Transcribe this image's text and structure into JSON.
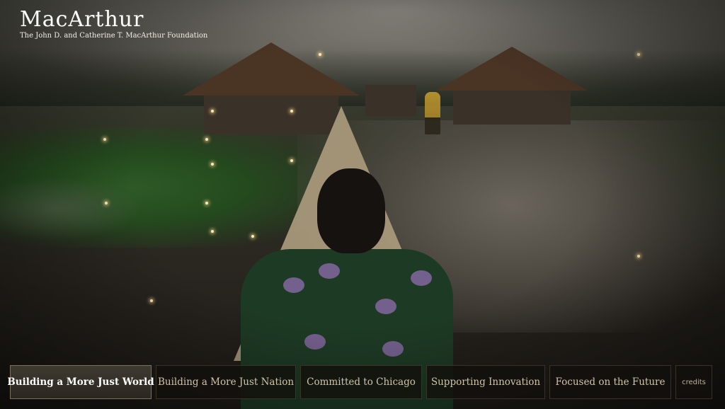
{
  "logo": {
    "title": "MacArthur",
    "subtitle": "The John D. and Catherine T. MacArthur Foundation"
  },
  "nav": {
    "items": [
      {
        "label": "Building a More Just World",
        "active": true
      },
      {
        "label": "Building a More Just Nation",
        "active": false
      },
      {
        "label": "Committed to Chicago",
        "active": false
      },
      {
        "label": "Supporting Innovation",
        "active": false
      },
      {
        "label": "Focused on the Future",
        "active": false
      },
      {
        "label": "credits",
        "active": false
      }
    ]
  },
  "colors": {
    "active_tab_bg": "#3e3a30",
    "tab_bg": "#12100c",
    "tab_text": "#cfc4a8"
  }
}
